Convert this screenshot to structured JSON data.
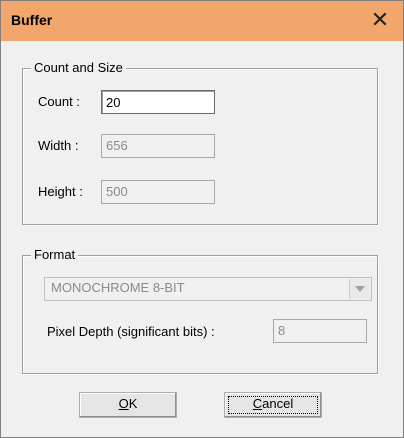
{
  "window": {
    "title": "Buffer",
    "close_glyph": "✕"
  },
  "count_size": {
    "legend": "Count and Size",
    "count": {
      "label": "Count :",
      "value": "20"
    },
    "width": {
      "label": "Width :",
      "value": "656"
    },
    "height": {
      "label": "Height :",
      "value": "500"
    }
  },
  "format": {
    "legend": "Format",
    "selected": "MONOCHROME 8-BIT",
    "pixel_depth": {
      "label": "Pixel Depth (significant bits) :",
      "value": "8"
    }
  },
  "buttons": {
    "ok": {
      "mnemonic": "O",
      "rest": "K"
    },
    "cancel": {
      "mnemonic": "C",
      "rest": "ancel"
    }
  },
  "colors": {
    "titlebar": "#f2a66b",
    "dialog_bg": "#f0f0f0"
  }
}
